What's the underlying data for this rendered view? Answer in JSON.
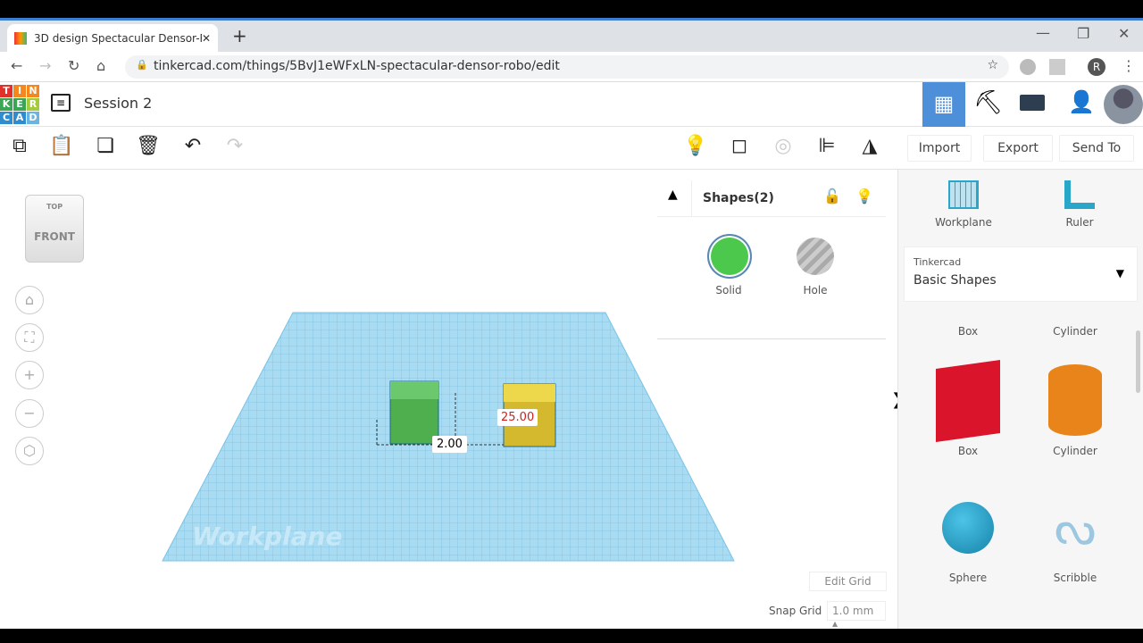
{
  "browser": {
    "tab_title": "3D design Spectacular Densor-R",
    "url": "tinkercad.com/things/5BvJ1eWFxLN-spectacular-densor-robo/edit",
    "profile": "R"
  },
  "app": {
    "logo": [
      "T",
      "I",
      "N",
      "K",
      "E",
      "R",
      "C",
      "A",
      "D"
    ],
    "title": "Session 2"
  },
  "toolbar": {
    "import": "Import",
    "export": "Export",
    "send_to": "Send To"
  },
  "viewcube": {
    "top": "TOP",
    "front": "FRONT"
  },
  "inspector": {
    "title": "Shapes(2)",
    "solid": "Solid",
    "hole": "Hole",
    "solid_color": "#4cc94c"
  },
  "viewport": {
    "workplane_label": "Workplane",
    "dim_gap": "2.00",
    "dim_active": "25.00",
    "edit_grid": "Edit Grid",
    "snap_label": "Snap Grid",
    "snap_value": "1.0 mm"
  },
  "library": {
    "workplane": "Workplane",
    "ruler": "Ruler",
    "category_sub": "Tinkercad",
    "category": "Basic Shapes",
    "shapes": [
      {
        "name": "Box",
        "color": "#d9142b"
      },
      {
        "name": "Cylinder",
        "color": "#e8841a"
      },
      {
        "name": "Sphere",
        "color": "#1a9cc9"
      },
      {
        "name": "Scribble",
        "color": "#9cc7e0"
      }
    ],
    "partial": [
      "Box",
      "Cylinder"
    ]
  }
}
